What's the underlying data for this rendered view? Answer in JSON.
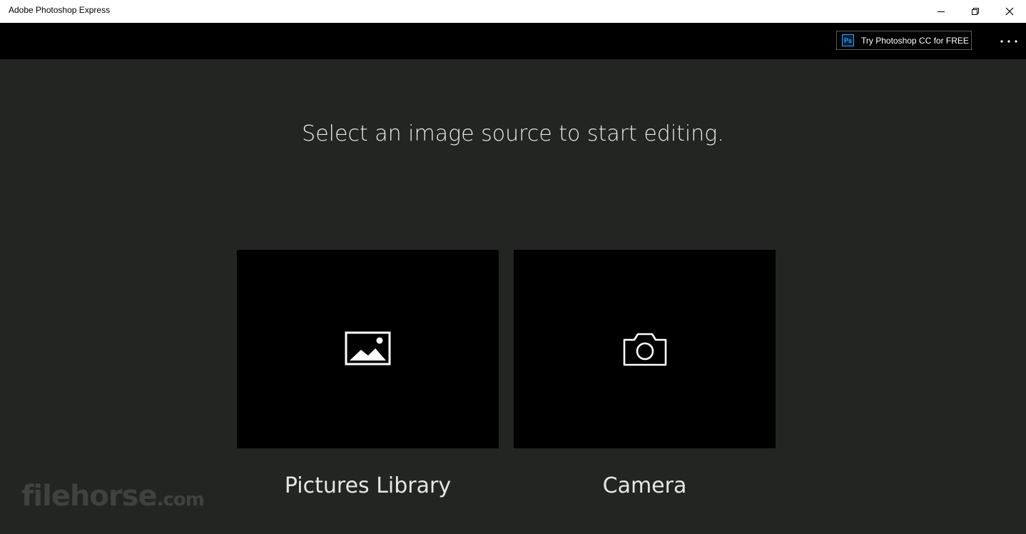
{
  "window": {
    "title": "Adobe Photoshop Express",
    "controls": [
      "minimize-icon",
      "maximize-icon",
      "close-icon"
    ]
  },
  "toolbar": {
    "promo": {
      "icon_text": "Ps",
      "label": "Try Photoshop CC for FREE"
    },
    "more_icon": "more-dots-icon"
  },
  "main": {
    "heading": "Select an image source to start editing.",
    "sources": [
      {
        "label": "Pictures Library",
        "icon": "image-icon"
      },
      {
        "label": "Camera",
        "icon": "camera-icon"
      }
    ]
  },
  "watermark": {
    "main": "filehorse",
    "suffix": ".com"
  },
  "colors": {
    "background": "#222522",
    "tile": "#000000",
    "toolbar": "#000000",
    "titlebar": "#ffffff",
    "ps_accent": "#31a8ff"
  }
}
